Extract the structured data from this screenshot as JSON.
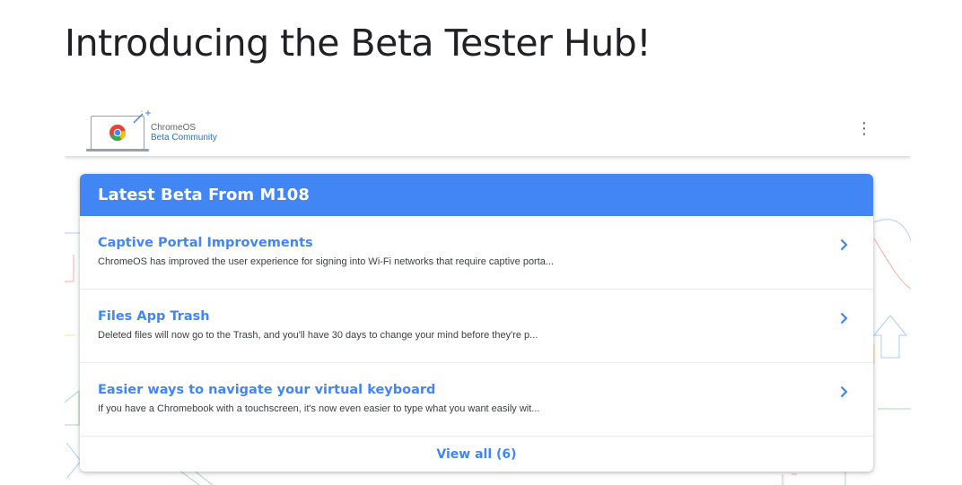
{
  "page": {
    "heading": "Introducing the Beta Tester Hub!"
  },
  "appbar": {
    "brand_line1": "ChromeOS",
    "brand_line2": "Beta Community",
    "menu_icon": "more-vert-icon"
  },
  "card": {
    "header": "Latest Beta From M108",
    "items": [
      {
        "title": "Captive Portal Improvements",
        "description": "ChromeOS has improved the user experience for signing into Wi-Fi networks that require captive porta..."
      },
      {
        "title": "Files App Trash",
        "description": "Deleted files will now go to the Trash, and you'll have 30 days to change your mind before they're p..."
      },
      {
        "title": "Easier ways to navigate your virtual keyboard",
        "description": "If you have a Chromebook with a touchscreen, it's now even easier to type what you want easily wit..."
      }
    ],
    "view_all": "View all (6)"
  },
  "colors": {
    "accent": "#4285f4",
    "header_bg": "#4285f4",
    "heading_text": "#202124",
    "body_text": "#3c4043",
    "brand_blue": "#1a73e8"
  }
}
